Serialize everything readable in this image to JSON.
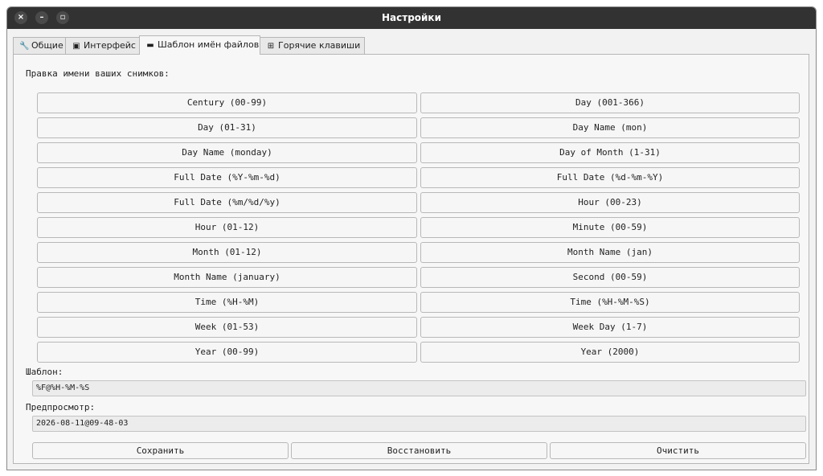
{
  "window": {
    "title": "Настройки"
  },
  "window_controls": {
    "close": "×",
    "minimize": "–",
    "maximize": "▫"
  },
  "tabs": [
    {
      "label": "Общие",
      "icon": "wrench-icon",
      "glyph": "🔧"
    },
    {
      "label": "Интерфейс",
      "icon": "display-icon",
      "glyph": "▣"
    },
    {
      "label": "Шаблон имён файлов",
      "icon": "filename-icon",
      "glyph": "▬",
      "active": true
    },
    {
      "label": "Горячие клавиши",
      "icon": "keyboard-icon",
      "glyph": "⊞"
    }
  ],
  "panel": {
    "heading": "Правка имени ваших снимков:",
    "buttons": [
      [
        "Century (00-99)",
        "Day (001-366)"
      ],
      [
        "Day (01-31)",
        "Day Name (mon)"
      ],
      [
        "Day Name (monday)",
        "Day of Month (1-31)"
      ],
      [
        "Full Date (%Y-%m-%d)",
        "Full Date (%d-%m-%Y)"
      ],
      [
        "Full Date (%m/%d/%y)",
        "Hour (00-23)"
      ],
      [
        "Hour (01-12)",
        "Minute (00-59)"
      ],
      [
        "Month (01-12)",
        "Month Name (jan)"
      ],
      [
        "Month Name (january)",
        "Second (00-59)"
      ],
      [
        "Time (%H-%M)",
        "Time (%H-%M-%S)"
      ],
      [
        "Week (01-53)",
        "Week Day (1-7)"
      ],
      [
        "Year (00-99)",
        "Year (2000)"
      ]
    ],
    "template_label": "Шаблон:",
    "template_value": "%F@%H-%M-%S",
    "preview_label": "Предпросмотр:",
    "preview_value": "2026-08-11@09-48-03",
    "save_label": "Сохранить",
    "restore_label": "Восстановить",
    "clear_label": "Очистить"
  }
}
